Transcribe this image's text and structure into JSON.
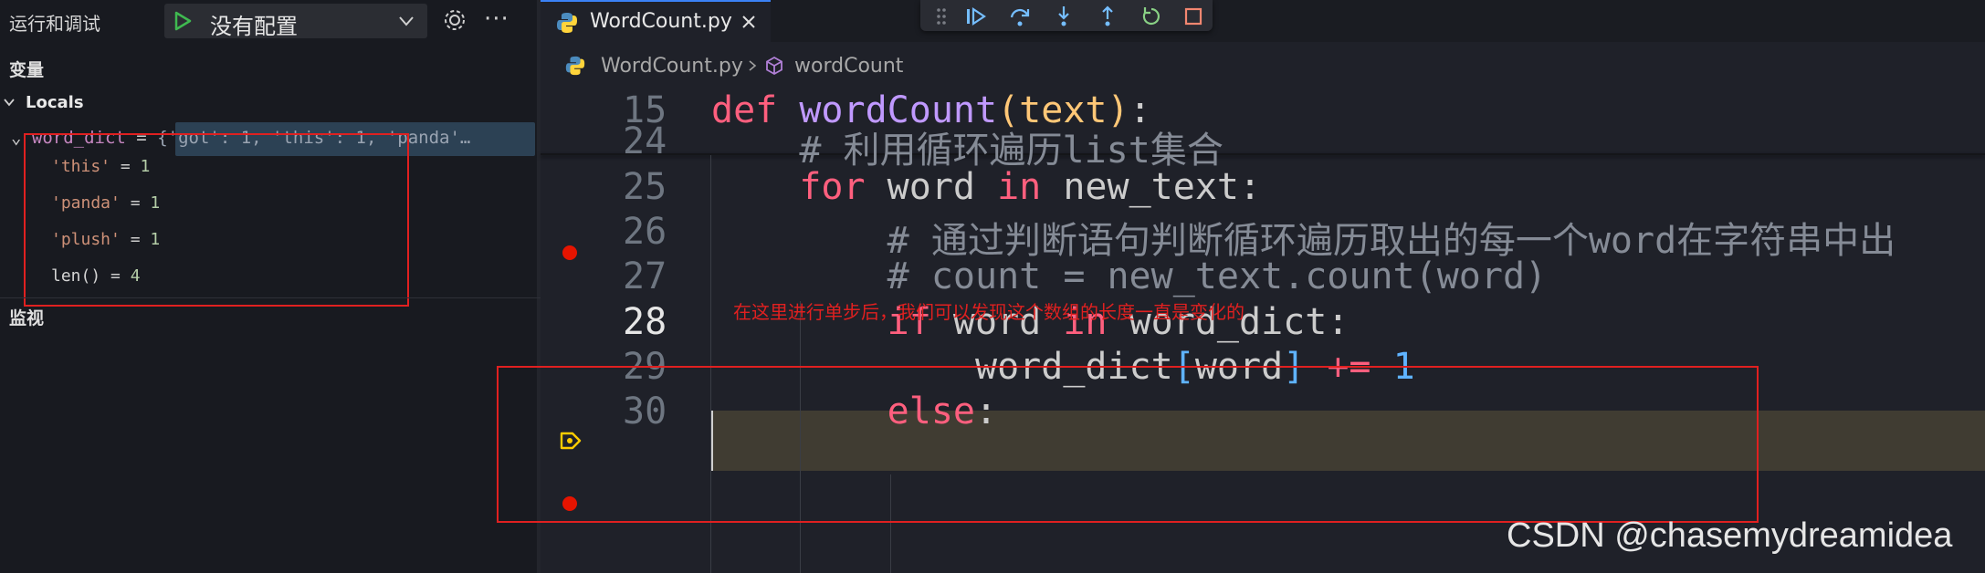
{
  "sidebar": {
    "title": "运行和调试",
    "config_label": "没有配置",
    "more_label": "···",
    "variables_title": "变量",
    "locals_label": "Locals",
    "watch_title": "监视",
    "word_dict": {
      "name": "word_dict",
      "eq": " = ",
      "value": "{'got': 1, 'this': 1, 'panda'…",
      "children": [
        {
          "key": "'this'",
          "eq": " = ",
          "value": "1"
        },
        {
          "key": "'panda'",
          "eq": " = ",
          "value": "1"
        },
        {
          "key": "'plush'",
          "eq": " = ",
          "value": "1"
        },
        {
          "key": "len()",
          "eq": " = ",
          "value": "4"
        }
      ]
    }
  },
  "editor": {
    "tab_name": "WordCount.py",
    "breadcrumb_file": "WordCount.py",
    "breadcrumb_symbol": "wordCount",
    "lines": [
      {
        "num": "15",
        "parts": [
          [
            "kw2",
            "def "
          ],
          [
            "fnc",
            "wordCount"
          ],
          [
            "par",
            "("
          ],
          [
            "par",
            "text"
          ],
          [
            "par",
            ")"
          ],
          [
            "eq",
            ":"
          ]
        ]
      },
      {
        "num": "24",
        "parts": [
          [
            "cmt",
            "    # 利用循环遍历list集合"
          ]
        ]
      },
      {
        "num": "25",
        "parts": [
          [
            "kw2",
            "    for "
          ],
          [
            "eq",
            "word "
          ],
          [
            "kw2",
            "in "
          ],
          [
            "eq",
            "new_text:"
          ]
        ]
      },
      {
        "num": "26",
        "parts": [
          [
            "cmt",
            "        # 通过判断语句判断循环遍历取出的每一个word在字符串中出"
          ]
        ]
      },
      {
        "num": "27",
        "parts": [
          [
            "cmt",
            "        # count = new_text.count(word)"
          ]
        ]
      },
      {
        "num": "28",
        "parts": [
          [
            "kw2",
            "        if "
          ],
          [
            "eq",
            "word "
          ],
          [
            "kw2",
            "in "
          ],
          [
            "eq",
            "word_dict:"
          ]
        ]
      },
      {
        "num": "29",
        "parts": [
          [
            "eq",
            "            word_dict"
          ],
          [
            "brk",
            "["
          ],
          [
            "eq",
            "word"
          ],
          [
            "brk",
            "]"
          ],
          [
            "op",
            " += "
          ],
          [
            "num",
            "1"
          ]
        ]
      },
      {
        "num": "30",
        "parts": [
          [
            "kw2",
            "        else"
          ],
          [
            "eq",
            ":"
          ]
        ]
      }
    ]
  },
  "annotation": "在这里进行单步后，我们可以发现这个数组的长度一直是变化的",
  "watermark": "CSDN @chasemydreamidea",
  "colors": {
    "breakpoint": "#e51400",
    "annotation_red": "#e02020",
    "current_line": "#403c32"
  }
}
